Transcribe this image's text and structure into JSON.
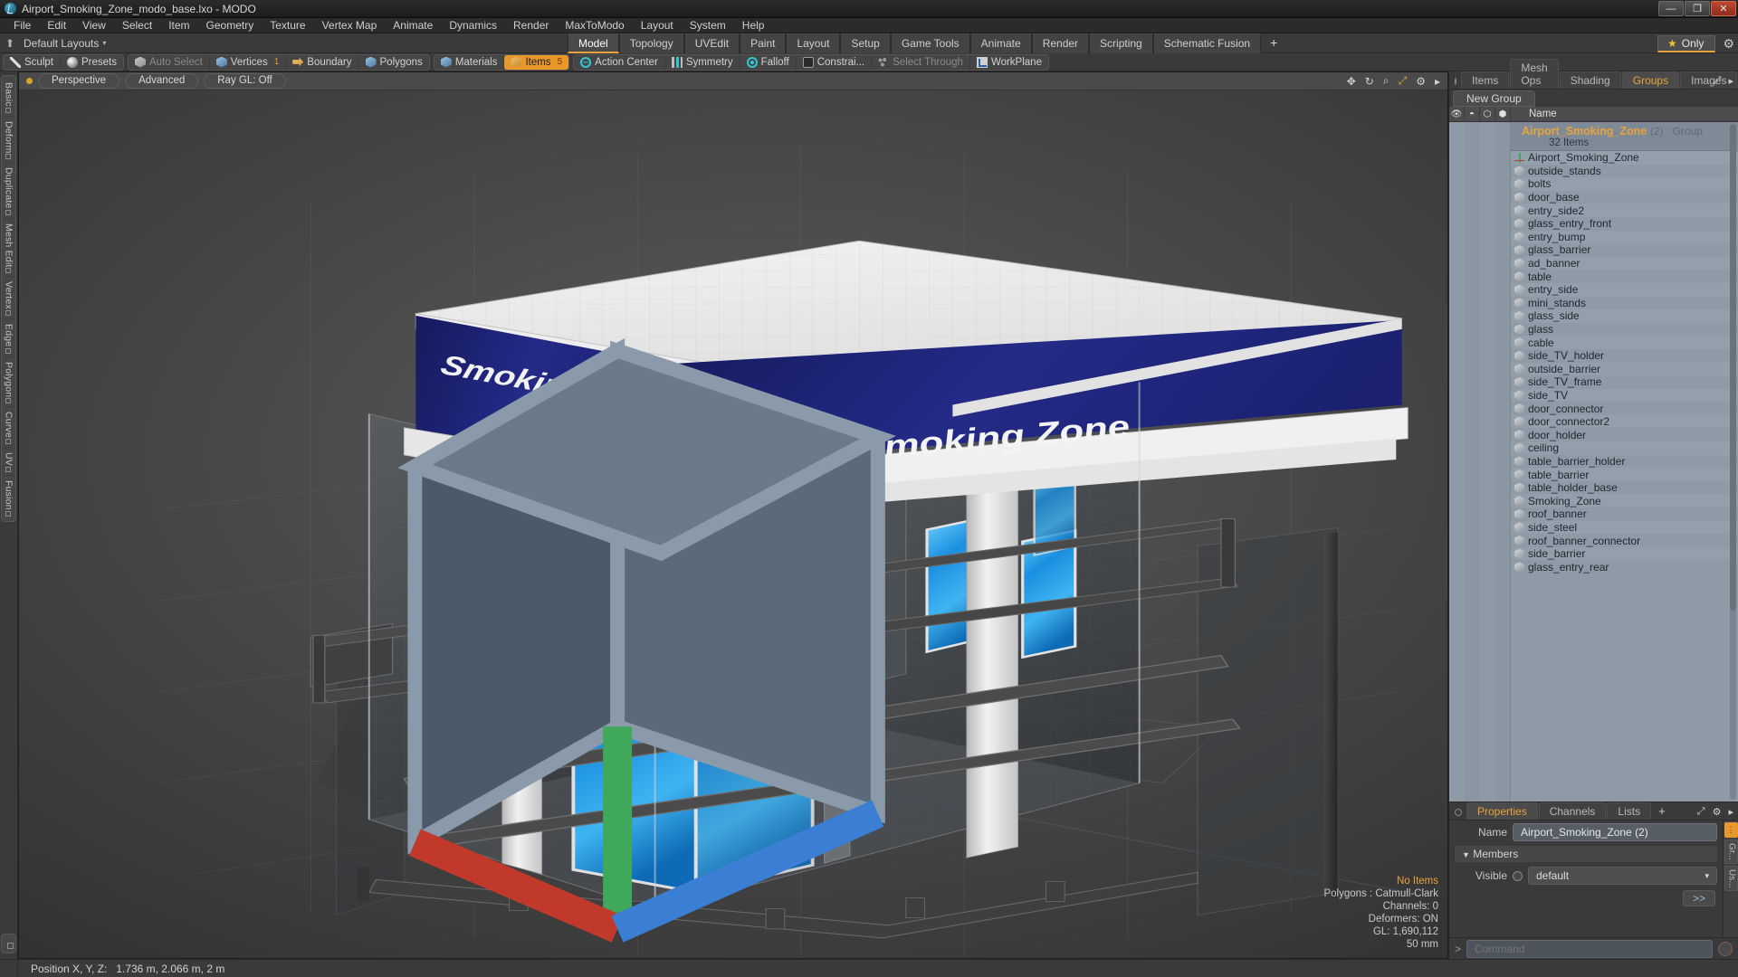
{
  "window": {
    "title": "Airport_Smoking_Zone_modo_base.lxo - MODO",
    "app_icon": "modo-logo-icon",
    "buttons": {
      "minimize": "—",
      "maximize": "❐",
      "close": "✕"
    }
  },
  "menubar": {
    "items": [
      "File",
      "Edit",
      "View",
      "Select",
      "Item",
      "Geometry",
      "Texture",
      "Vertex Map",
      "Animate",
      "Dynamics",
      "Render",
      "MaxToModo",
      "Layout",
      "System",
      "Help"
    ]
  },
  "layoutbar": {
    "home_icon": "home-icon",
    "layouts_label": "Default Layouts",
    "caret": "▾",
    "tabs": [
      {
        "label": "Model",
        "active": true
      },
      {
        "label": "Topology",
        "active": false
      },
      {
        "label": "UVEdit",
        "active": false
      },
      {
        "label": "Paint",
        "active": false
      },
      {
        "label": "Layout",
        "active": false
      },
      {
        "label": "Setup",
        "active": false
      },
      {
        "label": "Game Tools",
        "active": false
      },
      {
        "label": "Animate",
        "active": false
      },
      {
        "label": "Render",
        "active": false
      },
      {
        "label": "Scripting",
        "active": false
      },
      {
        "label": "Schematic Fusion",
        "active": false
      }
    ],
    "add_tab": "+",
    "only_label": "Only",
    "only_star": "★",
    "gear": "⚙"
  },
  "modebar": {
    "group1": [
      {
        "label": "Sculpt",
        "icon": "sculpt-icon",
        "state": "normal",
        "count": ""
      },
      {
        "label": "Presets",
        "icon": "presets-icon",
        "state": "normal",
        "count": ""
      }
    ],
    "group2": [
      {
        "label": "Auto Select",
        "icon": "cube-grey-icon",
        "state": "dim",
        "count": ""
      },
      {
        "label": "Vertices",
        "icon": "cube-blue-icon",
        "state": "normal",
        "count": "1"
      },
      {
        "label": "Boundary",
        "icon": "boundary-arrow-icon",
        "state": "normal",
        "count": ""
      },
      {
        "label": "Polygons",
        "icon": "cube-blue-icon",
        "state": "normal",
        "count": ""
      }
    ],
    "group3": [
      {
        "label": "Materials",
        "icon": "cube-blue-icon",
        "state": "normal",
        "count": ""
      },
      {
        "label": "Items",
        "icon": "cube-orange-icon",
        "state": "selected",
        "count": "5"
      }
    ],
    "group4": [
      {
        "label": "Action Center",
        "icon": "action-center-icon",
        "state": "normal",
        "count": ""
      },
      {
        "label": "Symmetry",
        "icon": "symmetry-icon",
        "state": "normal",
        "count": ""
      },
      {
        "label": "Falloff",
        "icon": "falloff-icon",
        "state": "normal",
        "count": ""
      },
      {
        "label": "Constrai...",
        "icon": "constraint-icon",
        "state": "normal",
        "count": ""
      },
      {
        "label": "Select Through",
        "icon": "select-through-icon",
        "state": "dim",
        "count": ""
      },
      {
        "label": "WorkPlane",
        "icon": "workplane-icon",
        "state": "normal",
        "count": ""
      }
    ]
  },
  "leftrail": {
    "tabs": [
      "Basic",
      "Deform",
      "Duplicate",
      "Mesh Edit",
      "Vertex",
      "Edge",
      "Polygon",
      "Curve",
      "UV",
      "Fusion"
    ]
  },
  "viewport": {
    "header": {
      "dot": "view-active-dot",
      "pills": [
        "Perspective",
        "Advanced",
        "Ray GL: Off"
      ],
      "icons": [
        "move-icon",
        "rotate-icon",
        "zoom-icon",
        "fit-icon",
        "gear-icon",
        "chevron-right-icon"
      ]
    },
    "model": {
      "banner_text": "Smoking Zone",
      "banner_color": "#1e2170",
      "screen_color": "#2aa6e8",
      "frame_color": "#e8e8e8"
    },
    "info": {
      "no_items": "No Items",
      "polygons": "Polygons : Catmull-Clark",
      "channels": "Channels: 0",
      "deformers": "Deformers: ON",
      "gl": "GL: 1,690,112",
      "grid": "50 mm"
    }
  },
  "rightpanel": {
    "tabs": [
      {
        "label": "Items",
        "active": false
      },
      {
        "label": "Mesh Ops",
        "active": false
      },
      {
        "label": "Shading",
        "active": false
      },
      {
        "label": "Groups",
        "active": true
      },
      {
        "label": "Images",
        "active": false
      }
    ],
    "add_tab": "+",
    "new_group_button": "New Group",
    "columns": [
      "eye-icon",
      "render-icon",
      "cube-outline-icon",
      "cube-solid-icon"
    ],
    "name_column": "Name",
    "group": {
      "name": "Airport_Smoking_Zone",
      "suffix": "(2) : Group",
      "count": "32 Items"
    },
    "items": [
      {
        "name": "Airport_Smoking_Zone",
        "icon": "mesh-axis-icon"
      },
      {
        "name": "outside_stands",
        "icon": "mesh-icon"
      },
      {
        "name": "bolts",
        "icon": "mesh-icon"
      },
      {
        "name": "door_base",
        "icon": "mesh-icon"
      },
      {
        "name": "entry_side2",
        "icon": "mesh-icon"
      },
      {
        "name": "glass_entry_front",
        "icon": "mesh-icon"
      },
      {
        "name": "entry_bump",
        "icon": "mesh-icon"
      },
      {
        "name": "glass_barrier",
        "icon": "mesh-icon"
      },
      {
        "name": "ad_banner",
        "icon": "mesh-icon"
      },
      {
        "name": "table",
        "icon": "mesh-icon"
      },
      {
        "name": "entry_side",
        "icon": "mesh-icon"
      },
      {
        "name": "mini_stands",
        "icon": "mesh-icon"
      },
      {
        "name": "glass_side",
        "icon": "mesh-icon"
      },
      {
        "name": "glass",
        "icon": "mesh-icon"
      },
      {
        "name": "cable",
        "icon": "mesh-icon"
      },
      {
        "name": "side_TV_holder",
        "icon": "mesh-icon"
      },
      {
        "name": "outside_barrier",
        "icon": "mesh-icon"
      },
      {
        "name": "side_TV_frame",
        "icon": "mesh-icon"
      },
      {
        "name": "side_TV",
        "icon": "mesh-icon"
      },
      {
        "name": "door_connector",
        "icon": "mesh-icon"
      },
      {
        "name": "door_connector2",
        "icon": "mesh-icon"
      },
      {
        "name": "door_holder",
        "icon": "mesh-icon"
      },
      {
        "name": "ceiling",
        "icon": "mesh-icon"
      },
      {
        "name": "table_barrier_holder",
        "icon": "mesh-icon"
      },
      {
        "name": "table_barrier",
        "icon": "mesh-icon"
      },
      {
        "name": "table_holder_base",
        "icon": "mesh-icon"
      },
      {
        "name": "Smoking_Zone",
        "icon": "mesh-icon"
      },
      {
        "name": "roof_banner",
        "icon": "mesh-icon"
      },
      {
        "name": "side_steel",
        "icon": "mesh-icon"
      },
      {
        "name": "roof_banner_connector",
        "icon": "mesh-icon"
      },
      {
        "name": "side_barrier",
        "icon": "mesh-icon"
      },
      {
        "name": "glass_entry_rear",
        "icon": "mesh-icon"
      }
    ]
  },
  "properties": {
    "tabs": [
      {
        "label": "Properties",
        "active": true
      },
      {
        "label": "Channels",
        "active": false
      },
      {
        "label": "Lists",
        "active": false
      }
    ],
    "add_tab": "+",
    "name_label": "Name",
    "name_value": "Airport_Smoking_Zone (2)",
    "members_label": "Members",
    "members_caret": "▼",
    "visible_label": "Visible",
    "visible_value": "default",
    "visible_caret": "▾",
    "expand_button": ">>",
    "side_tabs": [
      "Gr...",
      "Us..."
    ]
  },
  "commandbar": {
    "prompt": ">",
    "placeholder": "Command"
  },
  "statusbar": {
    "label": "Position X, Y, Z:",
    "value": "1.736 m, 2.066 m, 2 m"
  }
}
